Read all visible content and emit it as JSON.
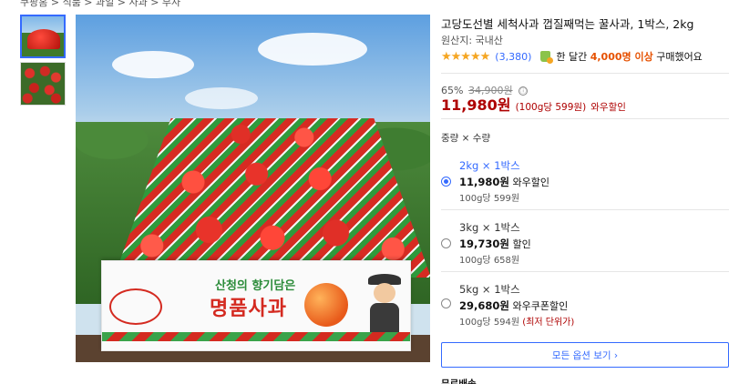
{
  "breadcrumb": "쿠팡홈 > 식품 > 과일 > 사과 > 부사",
  "product": {
    "title": "고당도선별 세척사과 껍질째먹는 꿀사과, 1박스, 2kg",
    "origin": "원산지: 국내산",
    "stars_glyphs": "★★★★★",
    "rating_value": 4.5,
    "review_count": "(3,380)",
    "buy_prefix": "한 달간",
    "buy_highlight": "4,000명 이상",
    "buy_suffix": "구매했어요"
  },
  "box_art": {
    "subtitle": "산청의 향기담은",
    "title": "명품사과"
  },
  "pricing": {
    "discount": "65%",
    "original": "34,900원",
    "info_icon": "ⓘ",
    "price": "11,980원",
    "unit_price": "(100g당 599원)",
    "wow_label": "와우할인"
  },
  "options": {
    "header": "중량 × 수량",
    "items": [
      {
        "name": "2kg × 1박스",
        "price": "11,980원",
        "label": "와우할인",
        "per": "100g당 599원",
        "extra": "",
        "selected": true
      },
      {
        "name": "3kg × 1박스",
        "price": "19,730원",
        "label": "할인",
        "per": "100g당 658원",
        "extra": "",
        "selected": false
      },
      {
        "name": "5kg × 1박스",
        "price": "29,680원",
        "label": "와우쿠폰할인",
        "per": "100g당 594원",
        "extra": "(최저 단위가)",
        "selected": false
      }
    ],
    "all_button": "모든 옵션 보기 ›"
  },
  "footer_partial": "무료배송",
  "colors": {
    "accent": "#346aff",
    "price_red": "#ae0000",
    "star": "#f5a623",
    "buy_highlight": "#e65100"
  },
  "icons": [
    "star-icon",
    "shopping-bag-icon",
    "info-icon",
    "radio-icon",
    "chevron-right-icon"
  ]
}
